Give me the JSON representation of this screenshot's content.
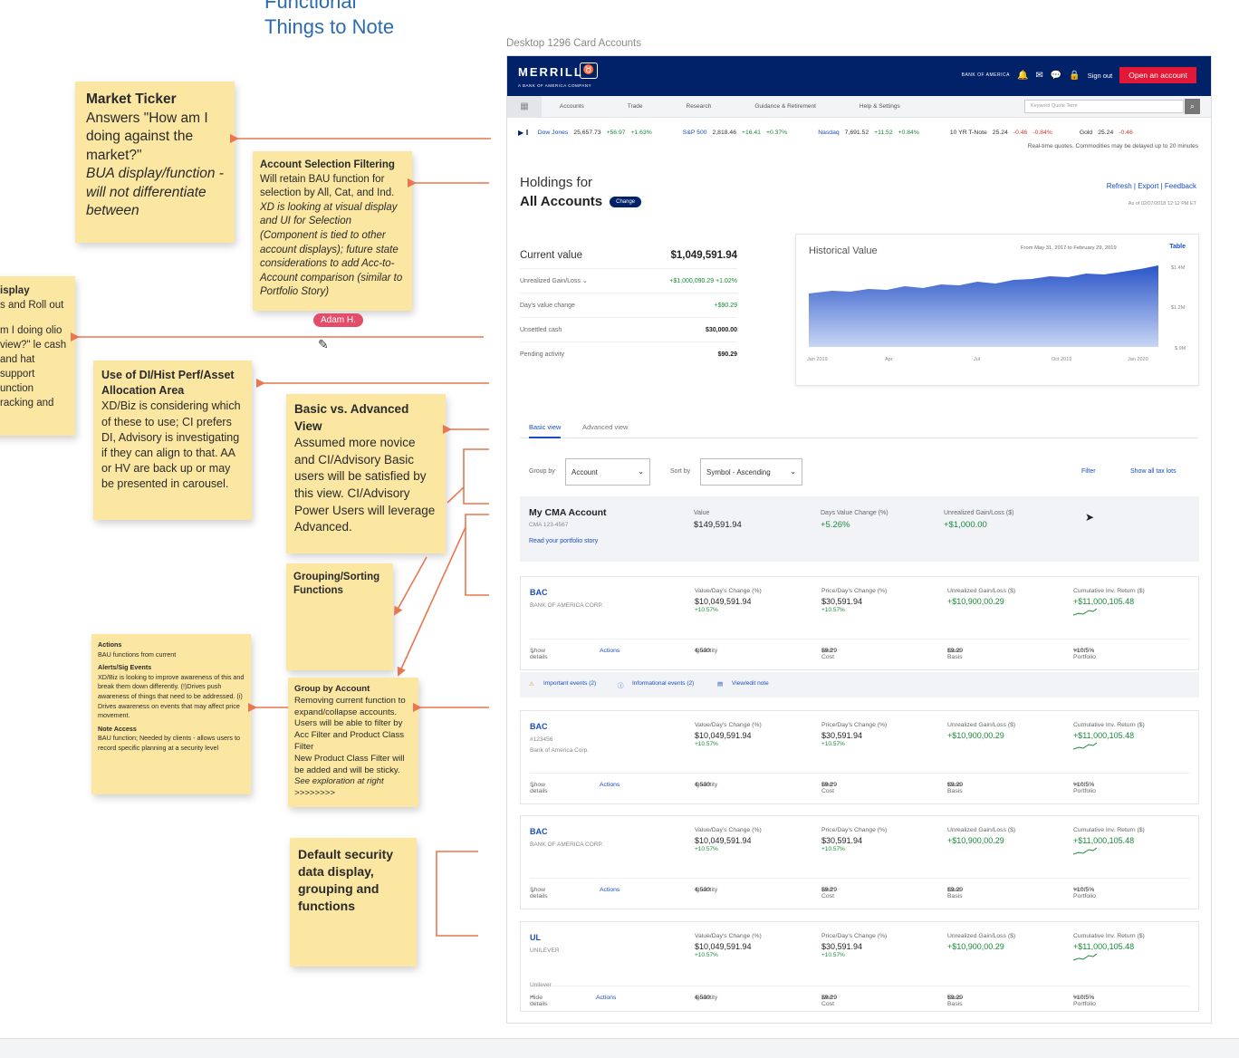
{
  "board": {
    "title_line1": "Functional",
    "title_line2": "Things to Note",
    "frame_label": "Desktop 1296 Card Accounts",
    "user_tag": "Adam H."
  },
  "notes": {
    "ticker": {
      "title": "Market Ticker",
      "body": "Answers \"How am I doing against the market?\"",
      "italic": "BUA display/function - will not differentiate between"
    },
    "account_selection": {
      "title": "Account Selection Filtering",
      "body": "Will retain BAU function for selection by All, Cat, and Ind.",
      "italic": "XD is looking at visual display and UI for Selection (Component is tied to other account displays); future state considerations to add Acc-to-Account comparison (similar to Portfolio Story)"
    },
    "display": {
      "title": "isplay",
      "body": "s and Roll out",
      "body2": "m I doing olio view?\" le cash and hat support unction racking and"
    },
    "di": {
      "title": "Use of DI/Hist Perf/Asset Allocation Area",
      "body": "XD/Biz is considering which of these to use; CI prefers DI, Advisory is investigating if they can align to that. AA or HV are back up or may be presented in carousel."
    },
    "basic_advanced": {
      "title": "Basic vs. Advanced View",
      "body": "Assumed more novice and CI/Advisory Basic users will be satisfied by this view. CI/Advisory Power Users will leverage Advanced."
    },
    "grouping": {
      "title": "Grouping/Sorting Functions"
    },
    "actions": {
      "t1": "Actions",
      "b1": "BAU functions from current",
      "t2": "Alerts/Sig Events",
      "b2": "XD/Biz is looking to improve awareness of this and break them down differently. (!)Drives push awareness of things that need to be addressed. (i) Drives awareness on events that may affect price movement.",
      "t3": "Note Access",
      "b3": "BAU function; Needed by clients - allows users to record specific planning at a security level"
    },
    "group_account": {
      "title": "Group by Account",
      "body": "Removing current function to expand/collapse accounts. Users will be able to filter by Acc Filter and Product Class Filter",
      "body2": "New Product Class Filter will be added and will be sticky.",
      "italic": "See exploration at right >>>>>>>>"
    },
    "default": {
      "title": "Default security data display, grouping and functions"
    }
  },
  "app": {
    "logo": "MERRILL",
    "logo_sub": "A BANK OF AMERICA COMPANY",
    "boa": "BANK OF AMERICA",
    "sign_out": "Sign out",
    "open_account": "Open an account",
    "nav": [
      "Accounts",
      "Trade",
      "Research",
      "Guidance & Retirement",
      "Help & Settings"
    ],
    "search_placeholder": "Keyword Quote Term",
    "ticker": {
      "dow_name": "Dow Jones",
      "dow_val": "25,657.73",
      "dow_chg": "+56.97",
      "dow_pct": "+1.63%",
      "sp_name": "S&P 500",
      "sp_val": "2,818.46",
      "sp_chg": "+16.41",
      "sp_pct": "+0.37%",
      "nas_name": "Nasdaq",
      "nas_val": "7,691.52",
      "nas_chg": "+11.52",
      "nas_pct": "+0.84%",
      "tn_name": "10 YR T-Note",
      "tn_val": "25.24",
      "tn_chg": "-0.46",
      "tn_pct": "-0.84%",
      "gold_name": "Gold",
      "gold_val": "25.24",
      "gold_chg": "-0.46",
      "disclaimer": "Real-time quotes. Commodities may be delayed up to 20 minutes"
    },
    "holdings_title": "Holdings for",
    "holdings_sub": "All Accounts",
    "change": "Change",
    "links": "Refresh  |  Export  |  Feedback",
    "asof": "As of 02/07/2018 12:12 PM ET",
    "summary": {
      "cv_label": "Current value",
      "cv": "$1,049,591.94",
      "ugl_label": "Unrealized Gain/Loss",
      "ugl": "+$1,000,090.29",
      "ugl_pct": "+1.02%",
      "dvc_label": "Day's value change",
      "dvc": "+$90.29",
      "uc_label": "Unsettled cash",
      "uc": "$30,000.00",
      "pa_label": "Pending activity",
      "pa": "$90.29"
    },
    "hist": {
      "title": "Historical Value",
      "range": "From May 31, 2017 to February 29, 2019",
      "table": "Table",
      "y_labels": [
        "$1.4M",
        "$1.2M",
        "$.9M"
      ],
      "x_labels": [
        "Jan 2019",
        "Apr",
        "Jul",
        "Oct 2019",
        "Jan 2020"
      ]
    },
    "tabs": {
      "basic": "Basic view",
      "advanced": "Advanced view"
    },
    "controls": {
      "group_by": "Group by",
      "group_val": "Account",
      "sort_by": "Sort by",
      "sort_val": "Symbol - Ascending",
      "filter": "Filter",
      "tax_lots": "Show all tax lots"
    },
    "account_card": {
      "name": "My CMA Account",
      "number": "CMA 123-4567",
      "story": "Read your portfolio story",
      "value_label": "Value",
      "value": "$149,591.94",
      "dvc_label": "Days Value Change (%)",
      "dvc": "+5.26%",
      "ugl_label": "Unrealized Gain/Loss ($)",
      "ugl": "+$1,000.00"
    },
    "col_labels": {
      "value": "Value/Day's Change (%)",
      "price": "Price/Day's Change (%)",
      "ugl": "Unrealized Gain/Loss ($)",
      "cum": "Cumulative Inv. Return ($)"
    },
    "holdings": [
      {
        "sym": "BAC",
        "name": "BANK OF AMERICA CORP.",
        "name2": "",
        "value": "$10,049,591.94",
        "vchg": "+10.57%",
        "price": "$30,591.94",
        "pchg": "+10.57%",
        "ugl": "+$10,900,00.29",
        "cum": "+$11,000,105.48",
        "details": "Show details",
        "actions": "Actions",
        "qty_label": "Quantity",
        "qty": "4,500",
        "uc_label": "Unit Cost",
        "uc": "$9.29",
        "cb_label": "Cost Basis",
        "cb": "$9.29",
        "pp_label": "% of Portfolio",
        "pp": "+10.5%",
        "extra": ""
      },
      {
        "sym": "BAC",
        "name": "#123456",
        "name2": "Bank of America Corp.",
        "value": "$10,049,591.94",
        "vchg": "+10.57%",
        "price": "$30,591.94",
        "pchg": "+10.57%",
        "ugl": "+$10,900,00.29",
        "cum": "+$11,000,105.48",
        "details": "Show details",
        "actions": "Actions",
        "qty_label": "Quantity",
        "qty": "4,500",
        "uc_label": "Unit Cost",
        "uc": "$9.29",
        "cb_label": "Cost Basis",
        "cb": "$9.29",
        "pp_label": "% of Portfolio",
        "pp": "+10.5%",
        "extra": ""
      },
      {
        "sym": "BAC",
        "name": "BANK OF AMERICA CORP.",
        "name2": "",
        "value": "$10,049,591.94",
        "vchg": "+10.57%",
        "price": "$30,591.94",
        "pchg": "+10.57%",
        "ugl": "+$10,900,00.29",
        "cum": "+$11,000,105.48",
        "details": "Show details",
        "actions": "Actions",
        "qty_label": "Quantity",
        "qty": "4,500",
        "uc_label": "Unit Cost",
        "uc": "$9.29",
        "cb_label": "Cost Basis",
        "cb": "$9.29",
        "pp_label": "% of Portfolio",
        "pp": "+10.5%",
        "extra": ""
      },
      {
        "sym": "UL",
        "name": "UNILEVER",
        "name2": "",
        "value": "$10,049,591.94",
        "vchg": "+10.57%",
        "price": "$30,591.94",
        "pchg": "+10.57%",
        "ugl": "+$10,900,00.29",
        "cum": "+$11,000,105.48",
        "details": "Hide details",
        "actions": "Actions",
        "qty_label": "Quantity",
        "qty": "4,500",
        "uc_label": "Unit Cost",
        "uc": "$9.29",
        "cb_label": "Cost Basis",
        "cb": "$9.29",
        "pp_label": "% of Portfolio",
        "pp": "+10.5%",
        "extra": "Unilever"
      }
    ],
    "events": {
      "important": "Important events (2)",
      "info": "Informational events (2)",
      "note": "View/edit note"
    }
  },
  "colors": {
    "navy": "#012169",
    "red": "#e31837",
    "sticky": "#fbe7a1",
    "link": "#1a4dbf",
    "gain": "#1a8a3a",
    "annot": "#e8764f"
  }
}
